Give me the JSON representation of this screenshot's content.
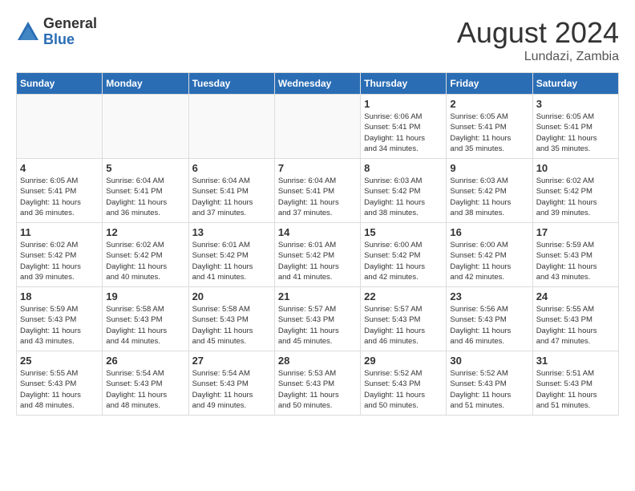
{
  "logo": {
    "general": "General",
    "blue": "Blue"
  },
  "title": "August 2024",
  "location": "Lundazi, Zambia",
  "weekdays": [
    "Sunday",
    "Monday",
    "Tuesday",
    "Wednesday",
    "Thursday",
    "Friday",
    "Saturday"
  ],
  "weeks": [
    [
      {
        "day": "",
        "info": ""
      },
      {
        "day": "",
        "info": ""
      },
      {
        "day": "",
        "info": ""
      },
      {
        "day": "",
        "info": ""
      },
      {
        "day": "1",
        "info": "Sunrise: 6:06 AM\nSunset: 5:41 PM\nDaylight: 11 hours\nand 34 minutes."
      },
      {
        "day": "2",
        "info": "Sunrise: 6:05 AM\nSunset: 5:41 PM\nDaylight: 11 hours\nand 35 minutes."
      },
      {
        "day": "3",
        "info": "Sunrise: 6:05 AM\nSunset: 5:41 PM\nDaylight: 11 hours\nand 35 minutes."
      }
    ],
    [
      {
        "day": "4",
        "info": "Sunrise: 6:05 AM\nSunset: 5:41 PM\nDaylight: 11 hours\nand 36 minutes."
      },
      {
        "day": "5",
        "info": "Sunrise: 6:04 AM\nSunset: 5:41 PM\nDaylight: 11 hours\nand 36 minutes."
      },
      {
        "day": "6",
        "info": "Sunrise: 6:04 AM\nSunset: 5:41 PM\nDaylight: 11 hours\nand 37 minutes."
      },
      {
        "day": "7",
        "info": "Sunrise: 6:04 AM\nSunset: 5:41 PM\nDaylight: 11 hours\nand 37 minutes."
      },
      {
        "day": "8",
        "info": "Sunrise: 6:03 AM\nSunset: 5:42 PM\nDaylight: 11 hours\nand 38 minutes."
      },
      {
        "day": "9",
        "info": "Sunrise: 6:03 AM\nSunset: 5:42 PM\nDaylight: 11 hours\nand 38 minutes."
      },
      {
        "day": "10",
        "info": "Sunrise: 6:02 AM\nSunset: 5:42 PM\nDaylight: 11 hours\nand 39 minutes."
      }
    ],
    [
      {
        "day": "11",
        "info": "Sunrise: 6:02 AM\nSunset: 5:42 PM\nDaylight: 11 hours\nand 39 minutes."
      },
      {
        "day": "12",
        "info": "Sunrise: 6:02 AM\nSunset: 5:42 PM\nDaylight: 11 hours\nand 40 minutes."
      },
      {
        "day": "13",
        "info": "Sunrise: 6:01 AM\nSunset: 5:42 PM\nDaylight: 11 hours\nand 41 minutes."
      },
      {
        "day": "14",
        "info": "Sunrise: 6:01 AM\nSunset: 5:42 PM\nDaylight: 11 hours\nand 41 minutes."
      },
      {
        "day": "15",
        "info": "Sunrise: 6:00 AM\nSunset: 5:42 PM\nDaylight: 11 hours\nand 42 minutes."
      },
      {
        "day": "16",
        "info": "Sunrise: 6:00 AM\nSunset: 5:42 PM\nDaylight: 11 hours\nand 42 minutes."
      },
      {
        "day": "17",
        "info": "Sunrise: 5:59 AM\nSunset: 5:43 PM\nDaylight: 11 hours\nand 43 minutes."
      }
    ],
    [
      {
        "day": "18",
        "info": "Sunrise: 5:59 AM\nSunset: 5:43 PM\nDaylight: 11 hours\nand 43 minutes."
      },
      {
        "day": "19",
        "info": "Sunrise: 5:58 AM\nSunset: 5:43 PM\nDaylight: 11 hours\nand 44 minutes."
      },
      {
        "day": "20",
        "info": "Sunrise: 5:58 AM\nSunset: 5:43 PM\nDaylight: 11 hours\nand 45 minutes."
      },
      {
        "day": "21",
        "info": "Sunrise: 5:57 AM\nSunset: 5:43 PM\nDaylight: 11 hours\nand 45 minutes."
      },
      {
        "day": "22",
        "info": "Sunrise: 5:57 AM\nSunset: 5:43 PM\nDaylight: 11 hours\nand 46 minutes."
      },
      {
        "day": "23",
        "info": "Sunrise: 5:56 AM\nSunset: 5:43 PM\nDaylight: 11 hours\nand 46 minutes."
      },
      {
        "day": "24",
        "info": "Sunrise: 5:55 AM\nSunset: 5:43 PM\nDaylight: 11 hours\nand 47 minutes."
      }
    ],
    [
      {
        "day": "25",
        "info": "Sunrise: 5:55 AM\nSunset: 5:43 PM\nDaylight: 11 hours\nand 48 minutes."
      },
      {
        "day": "26",
        "info": "Sunrise: 5:54 AM\nSunset: 5:43 PM\nDaylight: 11 hours\nand 48 minutes."
      },
      {
        "day": "27",
        "info": "Sunrise: 5:54 AM\nSunset: 5:43 PM\nDaylight: 11 hours\nand 49 minutes."
      },
      {
        "day": "28",
        "info": "Sunrise: 5:53 AM\nSunset: 5:43 PM\nDaylight: 11 hours\nand 50 minutes."
      },
      {
        "day": "29",
        "info": "Sunrise: 5:52 AM\nSunset: 5:43 PM\nDaylight: 11 hours\nand 50 minutes."
      },
      {
        "day": "30",
        "info": "Sunrise: 5:52 AM\nSunset: 5:43 PM\nDaylight: 11 hours\nand 51 minutes."
      },
      {
        "day": "31",
        "info": "Sunrise: 5:51 AM\nSunset: 5:43 PM\nDaylight: 11 hours\nand 51 minutes."
      }
    ]
  ]
}
